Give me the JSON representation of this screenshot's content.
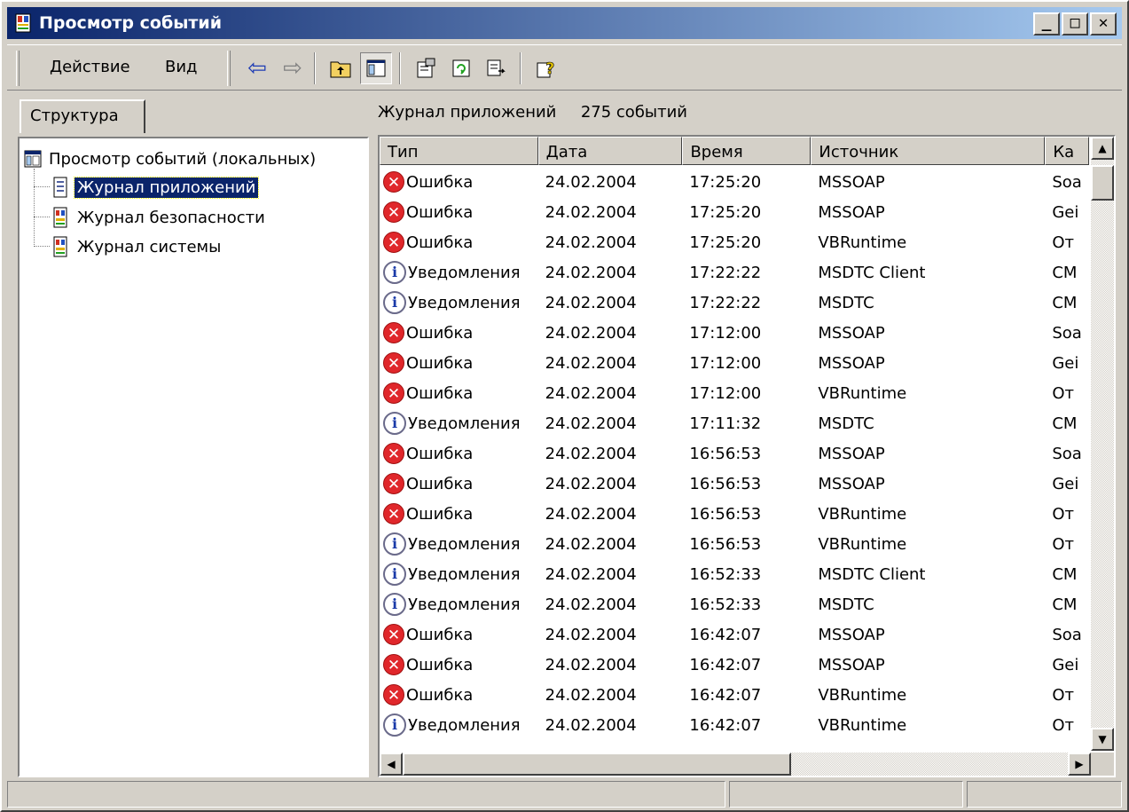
{
  "window": {
    "title": "Просмотр событий",
    "buttons": {
      "minimize": "_",
      "maximize": "□",
      "close": "✕"
    }
  },
  "menu": {
    "action": "Действие",
    "view": "Вид"
  },
  "toolbar": {
    "icons": [
      "back-arrow-icon",
      "forward-arrow-icon",
      "up-folder-icon",
      "show-hide-tree-icon",
      "properties-icon",
      "refresh-icon",
      "export-list-icon",
      "help-icon"
    ],
    "back_glyph": "⇦",
    "forward_glyph": "⇨"
  },
  "tabs": {
    "structure": "Структура"
  },
  "tree": {
    "root": "Просмотр событий (локальных)",
    "items": [
      "Журнал приложений",
      "Журнал безопасности",
      "Журнал системы"
    ],
    "selected": "Журнал приложений"
  },
  "log": {
    "name": "Журнал приложений",
    "count": "275 событий",
    "columns": [
      "Тип",
      "Дата",
      "Время",
      "Источник",
      "Ка"
    ],
    "rows": [
      {
        "kind": "error",
        "type": "Ошибка",
        "date": "24.02.2004",
        "time": "17:25:20",
        "source": "MSSOAP",
        "cat": "Soa"
      },
      {
        "kind": "error",
        "type": "Ошибка",
        "date": "24.02.2004",
        "time": "17:25:20",
        "source": "MSSOAP",
        "cat": "Gei"
      },
      {
        "kind": "error",
        "type": "Ошибка",
        "date": "24.02.2004",
        "time": "17:25:20",
        "source": "VBRuntime",
        "cat": "От"
      },
      {
        "kind": "info",
        "type": "Уведомления",
        "date": "24.02.2004",
        "time": "17:22:22",
        "source": "MSDTC Client",
        "cat": "CM"
      },
      {
        "kind": "info",
        "type": "Уведомления",
        "date": "24.02.2004",
        "time": "17:22:22",
        "source": "MSDTC",
        "cat": "CM"
      },
      {
        "kind": "error",
        "type": "Ошибка",
        "date": "24.02.2004",
        "time": "17:12:00",
        "source": "MSSOAP",
        "cat": "Soa"
      },
      {
        "kind": "error",
        "type": "Ошибка",
        "date": "24.02.2004",
        "time": "17:12:00",
        "source": "MSSOAP",
        "cat": "Gei"
      },
      {
        "kind": "error",
        "type": "Ошибка",
        "date": "24.02.2004",
        "time": "17:12:00",
        "source": "VBRuntime",
        "cat": "От"
      },
      {
        "kind": "info",
        "type": "Уведомления",
        "date": "24.02.2004",
        "time": "17:11:32",
        "source": "MSDTC",
        "cat": "CM"
      },
      {
        "kind": "error",
        "type": "Ошибка",
        "date": "24.02.2004",
        "time": "16:56:53",
        "source": "MSSOAP",
        "cat": "Soa"
      },
      {
        "kind": "error",
        "type": "Ошибка",
        "date": "24.02.2004",
        "time": "16:56:53",
        "source": "MSSOAP",
        "cat": "Gei"
      },
      {
        "kind": "error",
        "type": "Ошибка",
        "date": "24.02.2004",
        "time": "16:56:53",
        "source": "VBRuntime",
        "cat": "От"
      },
      {
        "kind": "info",
        "type": "Уведомления",
        "date": "24.02.2004",
        "time": "16:56:53",
        "source": "VBRuntime",
        "cat": "От"
      },
      {
        "kind": "info",
        "type": "Уведомления",
        "date": "24.02.2004",
        "time": "16:52:33",
        "source": "MSDTC Client",
        "cat": "CM"
      },
      {
        "kind": "info",
        "type": "Уведомления",
        "date": "24.02.2004",
        "time": "16:52:33",
        "source": "MSDTC",
        "cat": "CM"
      },
      {
        "kind": "error",
        "type": "Ошибка",
        "date": "24.02.2004",
        "time": "16:42:07",
        "source": "MSSOAP",
        "cat": "Soa"
      },
      {
        "kind": "error",
        "type": "Ошибка",
        "date": "24.02.2004",
        "time": "16:42:07",
        "source": "MSSOAP",
        "cat": "Gei"
      },
      {
        "kind": "error",
        "type": "Ошибка",
        "date": "24.02.2004",
        "time": "16:42:07",
        "source": "VBRuntime",
        "cat": "От"
      },
      {
        "kind": "info",
        "type": "Уведомления",
        "date": "24.02.2004",
        "time": "16:42:07",
        "source": "VBRuntime",
        "cat": "От"
      }
    ]
  },
  "colors": {
    "title_start": "#0a246a",
    "title_end": "#a6caf0",
    "face": "#d4d0c8",
    "selection": "#0a246a",
    "error_red": "#e0272b",
    "info_blue": "#1a3aa8"
  }
}
